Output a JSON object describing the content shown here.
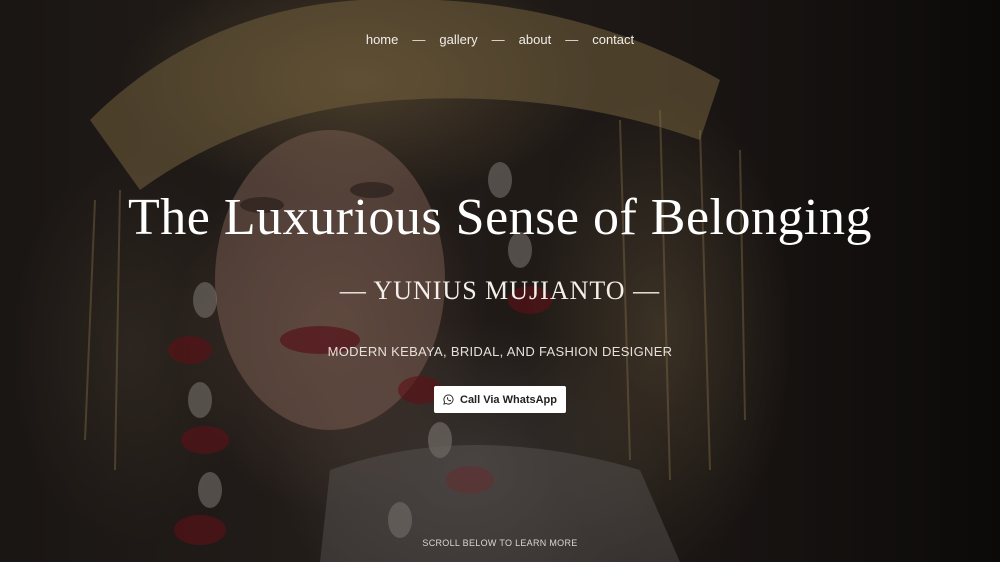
{
  "nav": {
    "items": [
      {
        "label": "home"
      },
      {
        "label": "gallery"
      },
      {
        "label": "about"
      },
      {
        "label": "contact"
      }
    ],
    "separator": "—"
  },
  "hero": {
    "title": "The Luxurious Sense of Belonging",
    "subtitle": "— YUNIUS MUJIANTO —",
    "tagline": "MODERN KEBAYA, BRIDAL, AND FASHION DESIGNER",
    "cta_label": "Call Via WhatsApp",
    "cta_icon": "whatsapp-icon",
    "scroll_hint": "SCROLL BELOW TO LEARN MORE"
  },
  "colors": {
    "text": "#ffffff",
    "button_bg": "#ffffff",
    "button_text": "#222222",
    "overlay": "rgba(0,0,0,0.38)"
  }
}
